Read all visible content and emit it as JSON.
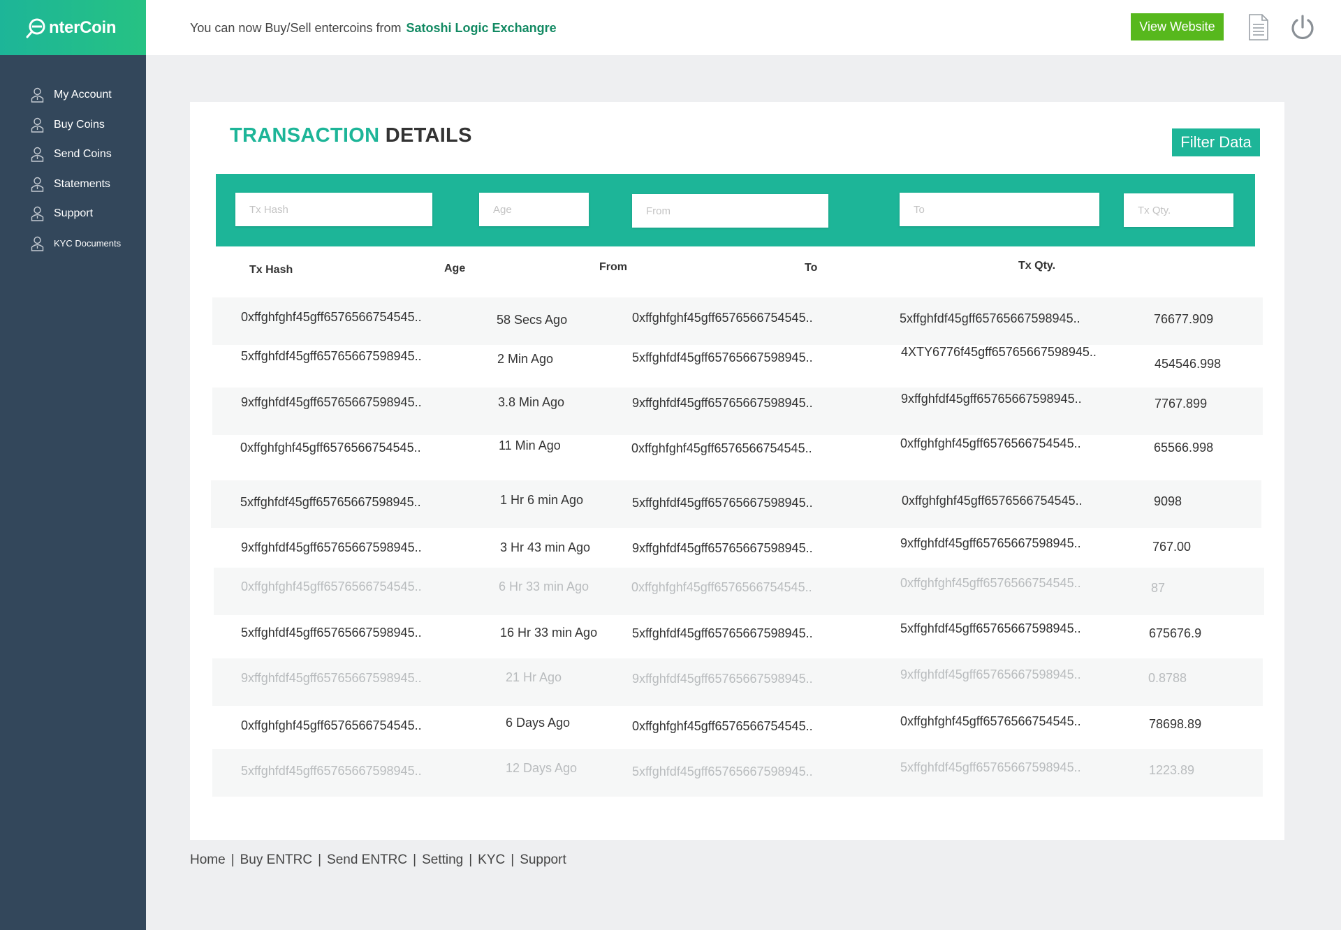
{
  "brand": {
    "name": "nterCoin"
  },
  "sidebar": {
    "items": [
      {
        "label": "My Account",
        "icon": "user-icon"
      },
      {
        "label": "Buy Coins",
        "icon": "user-icon"
      },
      {
        "label": "Send Coins",
        "icon": "user-icon"
      },
      {
        "label": "Statements",
        "icon": "user-icon"
      },
      {
        "label": "Support",
        "icon": "user-icon"
      },
      {
        "label": "KYC Documents",
        "icon": "user-icon"
      }
    ]
  },
  "header": {
    "announcement": "You can now Buy/Sell entercoins from",
    "exchange_link": "Satoshi Logic Exchangre",
    "view_website": "View Website",
    "doc_icon": "document-icon",
    "power_icon": "power-icon"
  },
  "card": {
    "title_accent": "TRANSACTION",
    "title_rest": "DETAILS",
    "filter_button": "Filter Data",
    "filters": {
      "tx_hash_placeholder": "Tx Hash",
      "age_placeholder": "Age",
      "from_placeholder": "From",
      "to_placeholder": "To",
      "qty_placeholder": "Tx Qty."
    },
    "columns": [
      "Tx Hash",
      "Age",
      "From",
      "To",
      "Tx Qty."
    ],
    "rows": [
      {
        "hash": "0xffghfghf45gff6576566754545..",
        "age": "58 Secs Ago",
        "from": "0xffghfghf45gff6576566754545..",
        "to": "5xffghfdf45gff65765667598945..",
        "qty": "76677.909"
      },
      {
        "hash": "5xffghfdf45gff65765667598945..",
        "age": "2 Min Ago",
        "from": "5xffghfdf45gff65765667598945..",
        "to": "4XTY6776f45gff65765667598945..",
        "qty": "454546.998"
      },
      {
        "hash": "9xffghfdf45gff65765667598945..",
        "age": "3.8 Min Ago",
        "from": "9xffghfdf45gff65765667598945..",
        "to": "9xffghfdf45gff65765667598945..",
        "qty": "7767.899"
      },
      {
        "hash": "0xffghfghf45gff6576566754545..",
        "age": "11 Min Ago",
        "from": "0xffghfghf45gff6576566754545..",
        "to": "0xffghfghf45gff6576566754545..",
        "qty": "65566.998"
      },
      {
        "hash": "5xffghfdf45gff65765667598945..",
        "age": "1 Hr 6 min Ago",
        "from": "5xffghfdf45gff65765667598945..",
        "to": "0xffghfghf45gff6576566754545..",
        "qty": "9098"
      },
      {
        "hash": "9xffghfdf45gff65765667598945..",
        "age": "3 Hr 43 min Ago",
        "from": "9xffghfdf45gff65765667598945..",
        "to": "9xffghfdf45gff65765667598945..",
        "qty": "767.00"
      },
      {
        "hash": "0xffghfghf45gff6576566754545..",
        "age": "6 Hr 33 min Ago",
        "from": "0xffghfghf45gff6576566754545..",
        "to": "0xffghfghf45gff6576566754545..",
        "qty": "87"
      },
      {
        "hash": "5xffghfdf45gff65765667598945..",
        "age": "16 Hr 33 min Ago",
        "from": "5xffghfdf45gff65765667598945..",
        "to": "5xffghfdf45gff65765667598945..",
        "qty": "675676.9"
      },
      {
        "hash": "9xffghfdf45gff65765667598945..",
        "age": "21 Hr  Ago",
        "from": "9xffghfdf45gff65765667598945..",
        "to": "9xffghfdf45gff65765667598945..",
        "qty": "0.8788"
      },
      {
        "hash": "0xffghfghf45gff6576566754545..",
        "age": "6 Days  Ago",
        "from": "0xffghfghf45gff6576566754545..",
        "to": "0xffghfghf45gff6576566754545..",
        "qty": "78698.89"
      },
      {
        "hash": "5xffghfdf45gff65765667598945..",
        "age": "12 Days  Ago",
        "from": "5xffghfdf45gff65765667598945..",
        "to": "5xffghfdf45gff65765667598945..",
        "qty": "1223.89"
      }
    ]
  },
  "footer": {
    "links": [
      "Home",
      "Buy ENTRC",
      "Send ENTRC",
      "Setting",
      "KYC",
      "Support"
    ],
    "separator": "|"
  },
  "colors": {
    "sidebar": "#33475b",
    "accent": "#1db598",
    "brand_green": "#57b81d",
    "link_green": "#138a63"
  }
}
